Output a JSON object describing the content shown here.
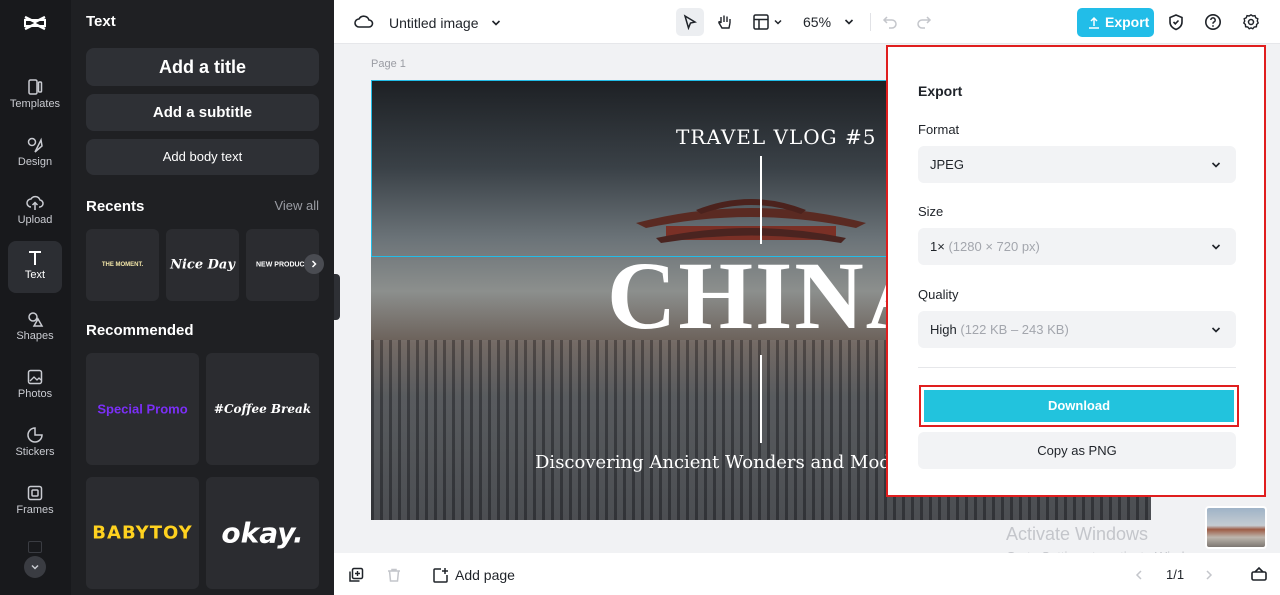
{
  "rail": {
    "items": [
      {
        "label": "Templates",
        "icon": "templates-icon"
      },
      {
        "label": "Design",
        "icon": "design-icon"
      },
      {
        "label": "Upload",
        "icon": "upload-icon"
      },
      {
        "label": "Text",
        "icon": "text-icon"
      },
      {
        "label": "Shapes",
        "icon": "shapes-icon"
      },
      {
        "label": "Photos",
        "icon": "photos-icon"
      },
      {
        "label": "Stickers",
        "icon": "stickers-icon"
      },
      {
        "label": "Frames",
        "icon": "frames-icon"
      }
    ]
  },
  "panel": {
    "title": "Text",
    "add_title": "Add a title",
    "add_subtitle": "Add a subtitle",
    "add_body": "Add body text",
    "recents_label": "Recents",
    "view_all": "View all",
    "recents": [
      "THE MOMENT.",
      "Nice Day",
      "NEW PRODUCT"
    ],
    "recommended_label": "Recommended",
    "recommended": [
      "Special Promo",
      "#Coffee Break",
      "BABYTOY",
      "okay."
    ]
  },
  "topbar": {
    "doc_title": "Untitled image",
    "zoom": "65%",
    "export_label": "Export"
  },
  "canvas": {
    "page_label": "Page 1",
    "travel": "TRAVEL VLOG #5",
    "china": "CHINA",
    "subtitle": "Discovering Ancient Wonders and Modern"
  },
  "export": {
    "title": "Export",
    "format_label": "Format",
    "format_value": "JPEG",
    "size_label": "Size",
    "size_value": "1×",
    "size_hint": "(1280 × 720 px)",
    "quality_label": "Quality",
    "quality_value": "High",
    "quality_hint": "(122 KB – 243 KB)",
    "download": "Download",
    "copy_png": "Copy as PNG"
  },
  "bottombar": {
    "add_page": "Add page",
    "page_count": "1/1"
  },
  "watermark": {
    "line1": "Activate Windows",
    "line2": "Go to Settings to activate Windows."
  },
  "colors": {
    "accent": "#22bde8",
    "highlight": "#e01e1e",
    "rail_bg": "#18191c",
    "panel_bg": "#1f2023"
  }
}
